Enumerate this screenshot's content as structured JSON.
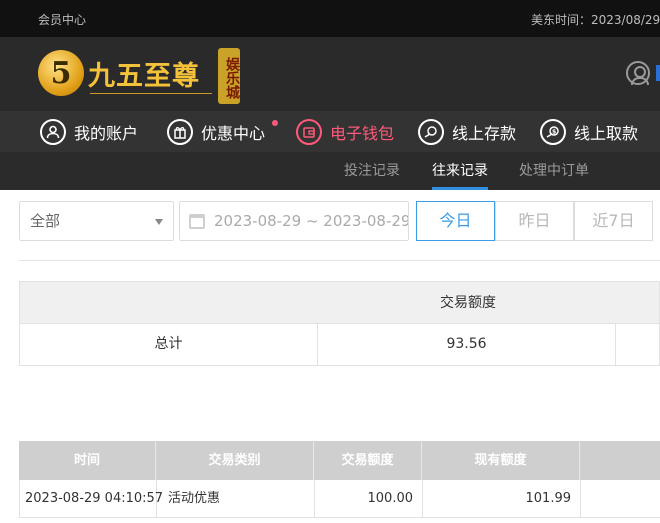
{
  "topbar": {
    "left": "会员中心",
    "right": "美东时间：2023/08/29"
  },
  "logo": {
    "numeral": "5",
    "brand": "九五至尊",
    "seal": "娱乐城"
  },
  "nav": [
    {
      "label": "我的账户",
      "icon": "user-icon"
    },
    {
      "label": "优惠中心",
      "icon": "gift-icon"
    },
    {
      "label": "电子钱包",
      "icon": "wallet-icon"
    },
    {
      "label": "线上存款",
      "icon": "deposit-icon"
    },
    {
      "label": "线上取款",
      "icon": "withdraw-icon"
    }
  ],
  "subnav": [
    {
      "label": "投注记录"
    },
    {
      "label": "往来记录"
    },
    {
      "label": "处理中订单"
    }
  ],
  "filters": {
    "type_select": "全部",
    "date_range": "2023-08-29 ~ 2023-08-29",
    "quick": [
      "今日",
      "昨日",
      "近7日"
    ]
  },
  "summary": {
    "header": "交易额度",
    "label": "总计",
    "value": "93.56"
  },
  "table": {
    "headers": [
      "时间",
      "交易类别",
      "交易额度",
      "现有额度"
    ],
    "rows": [
      [
        "2023-08-29 04:10:57",
        "活动优惠",
        "100.00",
        "101.99"
      ]
    ]
  },
  "colors": {
    "accent": "#3b9be6",
    "active_nav": "#ff5a7a",
    "gold": "#f3c13a"
  }
}
